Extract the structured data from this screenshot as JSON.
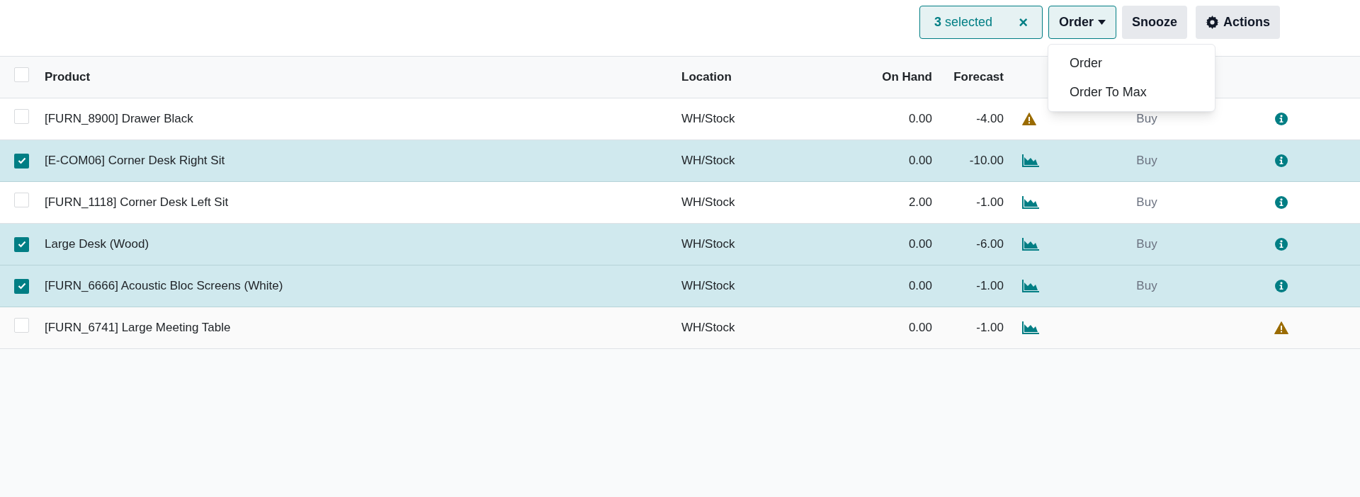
{
  "toolbar": {
    "selection": {
      "count": "3",
      "label": "selected",
      "clear": "×"
    },
    "buttons": [
      {
        "label": "Order",
        "kind": "dropdown",
        "open": true
      },
      {
        "label": "Snooze",
        "kind": "plain"
      },
      {
        "label": "Actions",
        "kind": "gear"
      }
    ],
    "menu": [
      "Order",
      "Order To Max"
    ]
  },
  "table": {
    "select_all": {
      "checked": false
    },
    "columns": [
      "Product",
      "Location",
      "On Hand",
      "Forecast"
    ],
    "rows": [
      {
        "selected": false,
        "product": "[FURN_8900] Drawer Black",
        "location": "WH/Stock",
        "on_hand": "0.00",
        "forecast": "-4.00",
        "forecast_warning": true,
        "route": "Buy",
        "stock_warning": false
      },
      {
        "selected": true,
        "product": "[E-COM06] Corner Desk Right Sit",
        "location": "WH/Stock",
        "on_hand": "0.00",
        "forecast": "-10.00",
        "forecast_warning": false,
        "route": "Buy",
        "stock_warning": false
      },
      {
        "selected": false,
        "product": "[FURN_1118] Corner Desk Left Sit",
        "location": "WH/Stock",
        "on_hand": "2.00",
        "forecast": "-1.00",
        "forecast_warning": false,
        "route": "Buy",
        "stock_warning": false
      },
      {
        "selected": true,
        "product": "Large Desk (Wood)",
        "location": "WH/Stock",
        "on_hand": "0.00",
        "forecast": "-6.00",
        "forecast_warning": false,
        "route": "Buy",
        "stock_warning": false
      },
      {
        "selected": true,
        "product": "[FURN_6666] Acoustic Bloc Screens (White)",
        "location": "WH/Stock",
        "on_hand": "0.00",
        "forecast": "-1.00",
        "forecast_warning": false,
        "route": "Buy",
        "stock_warning": false
      },
      {
        "selected": false,
        "product": "[FURN_6741] Large Meeting Table",
        "location": "WH/Stock",
        "on_hand": "0.00",
        "forecast": "-1.00",
        "forecast_warning": false,
        "stock_warning": true
      }
    ]
  }
}
